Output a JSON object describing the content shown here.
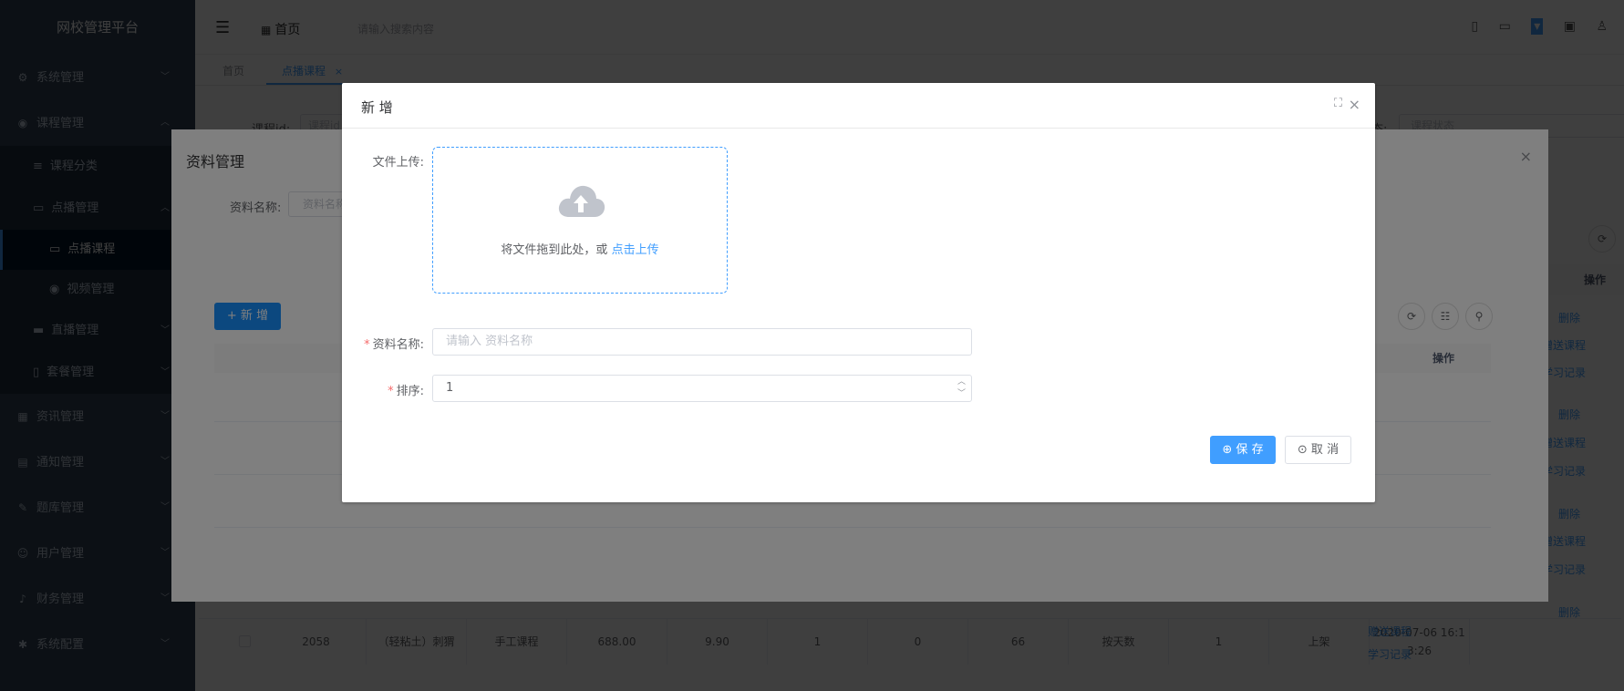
{
  "app": {
    "title": "网校管理平台"
  },
  "sidebar": {
    "items": [
      {
        "label": "系统管理",
        "icon": "gear-icon",
        "glyph": "⚙",
        "arrow": "﹀"
      },
      {
        "label": "课程管理",
        "icon": "play-circle-icon",
        "glyph": "◉",
        "arrow": "︿"
      },
      {
        "label": "课程分类",
        "icon": "list-icon",
        "glyph": "≡"
      },
      {
        "label": "点播管理",
        "icon": "video-icon",
        "glyph": "▭",
        "arrow": "︿"
      },
      {
        "label": "点播课程",
        "icon": "video-icon",
        "glyph": "▭"
      },
      {
        "label": "视频管理",
        "icon": "play-circle-icon",
        "glyph": "◉"
      },
      {
        "label": "直播管理",
        "icon": "camera-icon",
        "glyph": "▬",
        "arrow": "﹀"
      },
      {
        "label": "套餐管理",
        "icon": "book-icon",
        "glyph": "▯",
        "arrow": "﹀"
      },
      {
        "label": "资讯管理",
        "icon": "grid-icon",
        "glyph": "▦",
        "arrow": "﹀"
      },
      {
        "label": "通知管理",
        "icon": "message-icon",
        "glyph": "▤",
        "arrow": "﹀"
      },
      {
        "label": "题库管理",
        "icon": "edit-icon",
        "glyph": "✎",
        "arrow": "﹀"
      },
      {
        "label": "用户管理",
        "icon": "user-icon",
        "glyph": "☺",
        "arrow": "﹀"
      },
      {
        "label": "财务管理",
        "icon": "bell-icon",
        "glyph": "♪",
        "arrow": "﹀"
      },
      {
        "label": "系统配置",
        "icon": "gear-icon",
        "glyph": "✱",
        "arrow": "﹀"
      }
    ]
  },
  "navbar": {
    "hamburger": "☰",
    "home_icon": "▦",
    "home": "首页",
    "search_placeholder": "请输入搜索内容"
  },
  "tags": {
    "first": "首页",
    "active": "点播课程",
    "close": "×"
  },
  "filters": {
    "course_id_label": "课程id:",
    "course_id_placeholder": "课程id",
    "status_label": "态:",
    "status_placeholder": "课程状态"
  },
  "bg_table": {
    "op_header": "操作",
    "links": {
      "delete": "删除",
      "gift": "赠送课程",
      "study": "学习记录"
    },
    "row": {
      "id": "2058",
      "name": "（轻粘土）刺猬",
      "category": "手工课程",
      "price": "688.00",
      "sale_price": "9.90",
      "c1": "1",
      "c2": "0",
      "c3": "66",
      "mode": "按天数",
      "c4": "1",
      "status": "上架",
      "date1": "2020-07-06 16:1",
      "date2": "3:26"
    }
  },
  "materials_dialog": {
    "title": "资料管理",
    "close": "×",
    "name_label": "资料名称:",
    "name_placeholder": "资料名称",
    "add_button": "+ 新 增",
    "op_header": "操作"
  },
  "add_dialog": {
    "title": "新 增",
    "fullscreen": "⛶",
    "close": "×",
    "upload_label": "文件上传:",
    "upload_text": "将文件拖到此处，或",
    "upload_link": "点击上传",
    "name_label": "资料名称:",
    "name_placeholder": "请输入 资料名称",
    "sort_label": "排序:",
    "sort_value": "1",
    "save_button": "⊕ 保 存",
    "cancel_button": "⊙ 取 消"
  }
}
